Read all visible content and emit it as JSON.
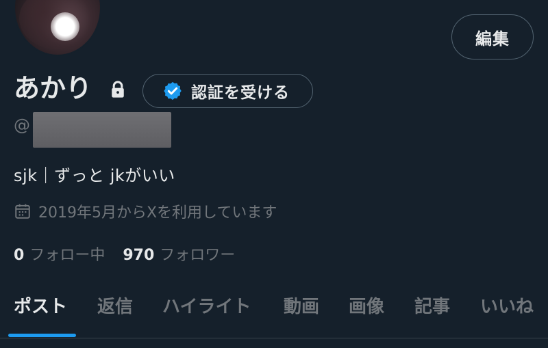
{
  "profile": {
    "display_name": "あかり",
    "handle_prefix": "@",
    "bio": "sjk｜ずっと jkがいい",
    "joined": "2019年5月からXを利用しています"
  },
  "actions": {
    "edit_label": "編集",
    "verify_label": "認証を受ける"
  },
  "stats": {
    "following_count": "0",
    "following_label": "フォロー中",
    "followers_count": "970",
    "followers_label": "フォロワー"
  },
  "tabs": [
    {
      "label": "ポスト",
      "active": true
    },
    {
      "label": "返信",
      "active": false
    },
    {
      "label": "ハイライト",
      "active": false
    },
    {
      "label": "動画",
      "active": false
    },
    {
      "label": "画像",
      "active": false
    },
    {
      "label": "記事",
      "active": false
    },
    {
      "label": "いいね",
      "active": false
    }
  ],
  "icons": {
    "lock": "lock-icon",
    "verified": "verified-badge-icon",
    "calendar": "calendar-icon"
  },
  "colors": {
    "background": "#15202b",
    "accent": "#1d9bf0",
    "text_primary": "#e7e9ea",
    "text_secondary": "#71767b",
    "border": "#536471"
  }
}
